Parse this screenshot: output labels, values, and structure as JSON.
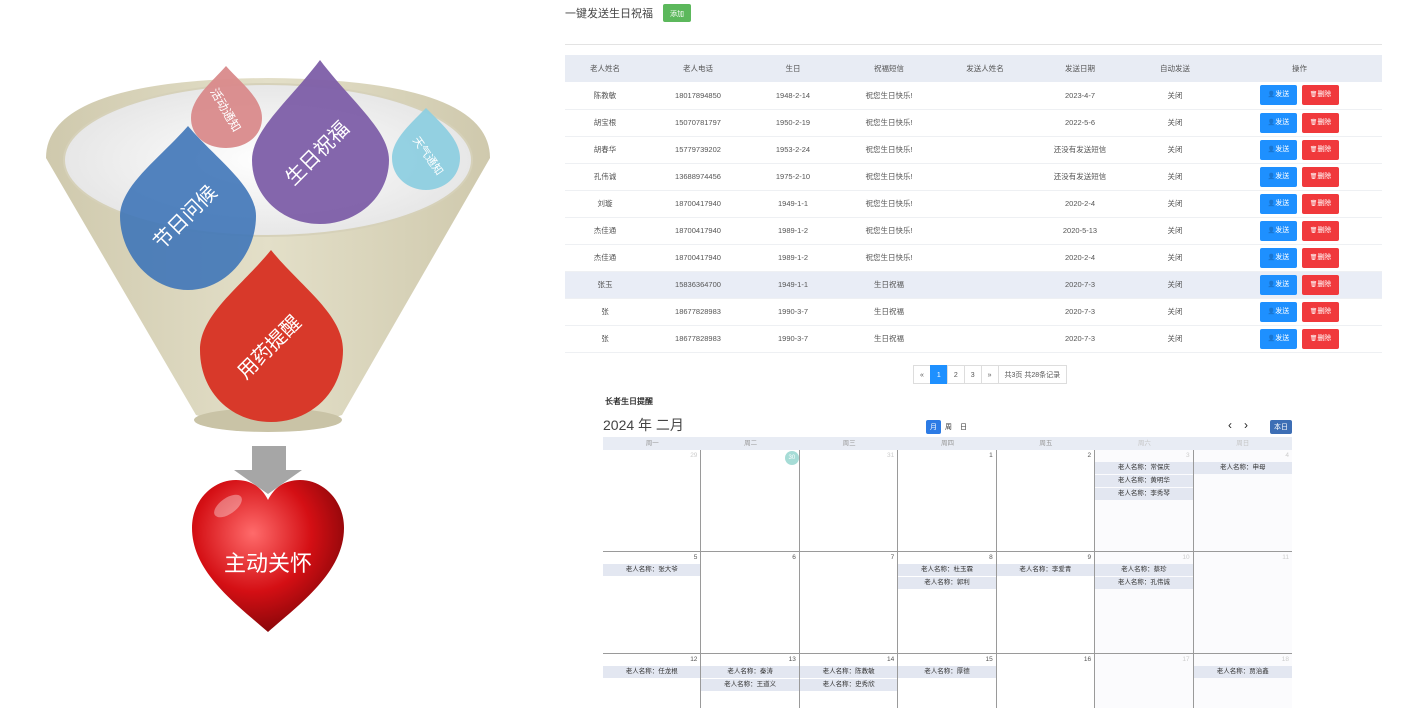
{
  "illustration": {
    "drops": {
      "activity": "活动通知",
      "birthday": "生日祝福",
      "weather": "天气通知",
      "festival": "节日问候",
      "medicine": "用药提醒"
    },
    "heart_label": "主动关怀"
  },
  "toolbar": {
    "title": "一键发送生日祝福",
    "add_label": "添加"
  },
  "table": {
    "headers": [
      "老人姓名",
      "老人电话",
      "生日",
      "祝福短信",
      "发送人姓名",
      "发送日期",
      "自动发送",
      "操作"
    ],
    "send_label": "发送",
    "delete_label": "删除",
    "rows": [
      {
        "name": "陈教敏",
        "phone": "18017894850",
        "birthday": "1948-2-14",
        "sms": "祝您生日快乐!",
        "sender": "",
        "date": "2023-4-7",
        "auto": "关闭"
      },
      {
        "name": "胡宝根",
        "phone": "15070781797",
        "birthday": "1950-2-19",
        "sms": "祝您生日快乐!",
        "sender": "",
        "date": "2022-5-6",
        "auto": "关闭"
      },
      {
        "name": "胡春华",
        "phone": "15779739202",
        "birthday": "1953-2-24",
        "sms": "祝您生日快乐!",
        "sender": "",
        "date": "还没有发送短信",
        "auto": "关闭"
      },
      {
        "name": "孔伟诚",
        "phone": "13688974456",
        "birthday": "1975-2-10",
        "sms": "祝您生日快乐!",
        "sender": "",
        "date": "还没有发送短信",
        "auto": "关闭"
      },
      {
        "name": "刘璇",
        "phone": "18700417940",
        "birthday": "1949-1-1",
        "sms": "祝您生日快乐!",
        "sender": "",
        "date": "2020-2-4",
        "auto": "关闭"
      },
      {
        "name": "杰佳通",
        "phone": "18700417940",
        "birthday": "1989-1-2",
        "sms": "祝您生日快乐!",
        "sender": "",
        "date": "2020-5-13",
        "auto": "关闭"
      },
      {
        "name": "杰佳通",
        "phone": "18700417940",
        "birthday": "1989-1-2",
        "sms": "祝您生日快乐!",
        "sender": "",
        "date": "2020-2-4",
        "auto": "关闭"
      },
      {
        "name": "张玉",
        "phone": "15836364700",
        "birthday": "1949-1-1",
        "sms": "生日祝福",
        "sender": "",
        "date": "2020-7-3",
        "auto": "关闭"
      },
      {
        "name": "张",
        "phone": "18677828983",
        "birthday": "1990-3-7",
        "sms": "生日祝福",
        "sender": "",
        "date": "2020-7-3",
        "auto": "关闭"
      },
      {
        "name": "张",
        "phone": "18677828983",
        "birthday": "1990-3-7",
        "sms": "生日祝福",
        "sender": "",
        "date": "2020-7-3",
        "auto": "关闭"
      }
    ],
    "highlighted_row": 7
  },
  "pager": {
    "prev": "«",
    "pages": [
      "1",
      "2",
      "3"
    ],
    "active_page": 1,
    "next": "»",
    "summary": "共3页 共28条记录"
  },
  "calendar": {
    "section_title": "长者生日提醒",
    "month_title": "2024 年 二月",
    "views": [
      "月",
      "周",
      "日"
    ],
    "active_view": "月",
    "prev": "‹",
    "next": "›",
    "today_label": "本日",
    "weekdays": [
      "周一",
      "周二",
      "周三",
      "周四",
      "周五",
      "周六",
      "周日"
    ],
    "weeks": [
      {
        "days": [
          {
            "num": "29",
            "dim": true,
            "events": []
          },
          {
            "num": "30",
            "today": true,
            "events": []
          },
          {
            "num": "31",
            "dim": true,
            "events": []
          },
          {
            "num": "1",
            "events": []
          },
          {
            "num": "2",
            "events": []
          },
          {
            "num": "3",
            "events": [
              "老人名称：常保庆",
              "老人名称：黄明华",
              "老人名称：李秀琴"
            ]
          },
          {
            "num": "4",
            "events": [
              "老人名称：申母"
            ]
          }
        ]
      },
      {
        "days": [
          {
            "num": "5",
            "events": [
              "老人名称：张大爷"
            ]
          },
          {
            "num": "6",
            "events": []
          },
          {
            "num": "7",
            "events": []
          },
          {
            "num": "8",
            "events": [
              "老人名称：杜玉霖",
              "老人名称：郭利"
            ]
          },
          {
            "num": "9",
            "events": [
              "老人名称：李爱青"
            ]
          },
          {
            "num": "10",
            "events": [
              "老人名称：蔡珍",
              "老人名称：孔伟诚"
            ]
          },
          {
            "num": "11",
            "events": []
          }
        ]
      },
      {
        "days": [
          {
            "num": "12",
            "events": [
              "老人名称：任龙根"
            ]
          },
          {
            "num": "13",
            "events": [
              "老人名称：秦涛",
              "老人名称：王道义"
            ]
          },
          {
            "num": "14",
            "events": [
              "老人名称：陈教敏",
              "老人名称：史秀欣"
            ]
          },
          {
            "num": "15",
            "events": [
              "老人名称：厚德"
            ]
          },
          {
            "num": "16",
            "events": []
          },
          {
            "num": "17",
            "events": []
          },
          {
            "num": "18",
            "events": [
              "老人名称：贾治鑫"
            ]
          }
        ]
      }
    ]
  },
  "colors": {
    "send": "#1e90ff",
    "delete": "#f0393c",
    "add": "#5cb85c",
    "drop_activity": "#d98a8b",
    "drop_birthday": "#7d5ea8",
    "drop_weather": "#8ecfe0",
    "drop_festival": "#3f76b8",
    "drop_medicine": "#d8392a"
  }
}
